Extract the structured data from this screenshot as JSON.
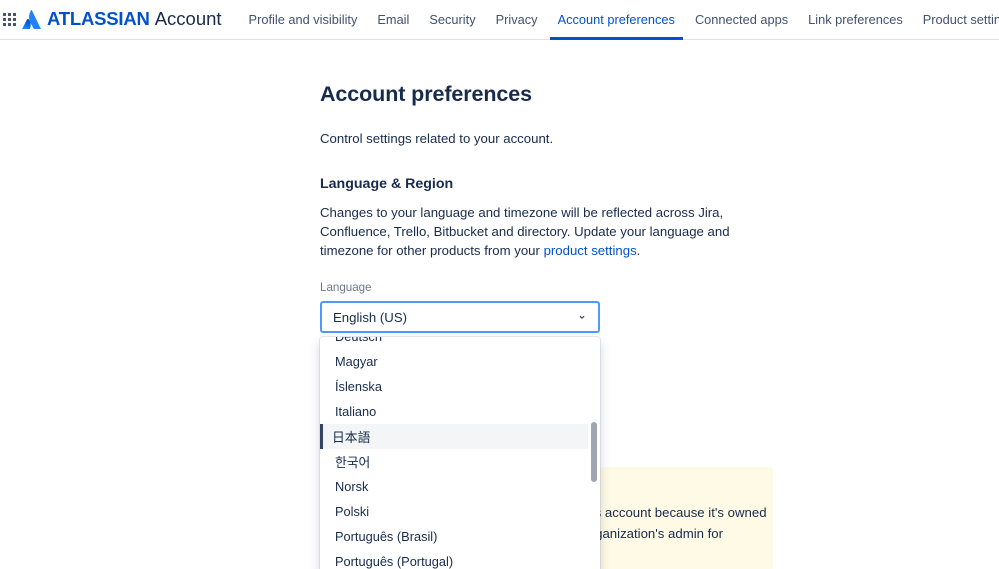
{
  "header": {
    "app_switcher_icon": "grid-apps-icon",
    "brand_mark_icon": "atlassian-logo-icon",
    "brand_name": "ATLASSIAN",
    "brand_product": "Account",
    "nav": [
      {
        "label": "Profile and visibility",
        "active": false
      },
      {
        "label": "Email",
        "active": false
      },
      {
        "label": "Security",
        "active": false
      },
      {
        "label": "Privacy",
        "active": false
      },
      {
        "label": "Account preferences",
        "active": true
      },
      {
        "label": "Connected apps",
        "active": false
      },
      {
        "label": "Link preferences",
        "active": false
      },
      {
        "label": "Product settings",
        "active": false
      }
    ],
    "accent_color": "#0052cc"
  },
  "main": {
    "title": "Account preferences",
    "subtitle": "Control settings related to your account.",
    "section": {
      "title": "Language & Region",
      "description_part1": "Changes to your language and timezone will be reflected across Jira, Confluence, Trello, Bitbucket and directory. Update your language and timezone for other products from your ",
      "description_link": "product settings",
      "description_part2": "."
    },
    "language_field": {
      "label": "Language",
      "selected_value": "English (US)",
      "chevron_icon": "chevron-down-icon",
      "options": [
        {
          "label": "Deutsch",
          "selected": false
        },
        {
          "label": "Magyar",
          "selected": false
        },
        {
          "label": "Íslenska",
          "selected": false
        },
        {
          "label": "Italiano",
          "selected": false
        },
        {
          "label": "日本語",
          "selected": true
        },
        {
          "label": "한국어",
          "selected": false
        },
        {
          "label": "Norsk",
          "selected": false
        },
        {
          "label": "Polski",
          "selected": false
        },
        {
          "label": "Português (Brasil)",
          "selected": false
        },
        {
          "label": "Português (Portugal)",
          "selected": false
        }
      ]
    },
    "warning": {
      "text": "Your organization manages this account because it's owned and managed. Contact your organization's admin for assistance.",
      "background_color": "#fffae6"
    }
  }
}
